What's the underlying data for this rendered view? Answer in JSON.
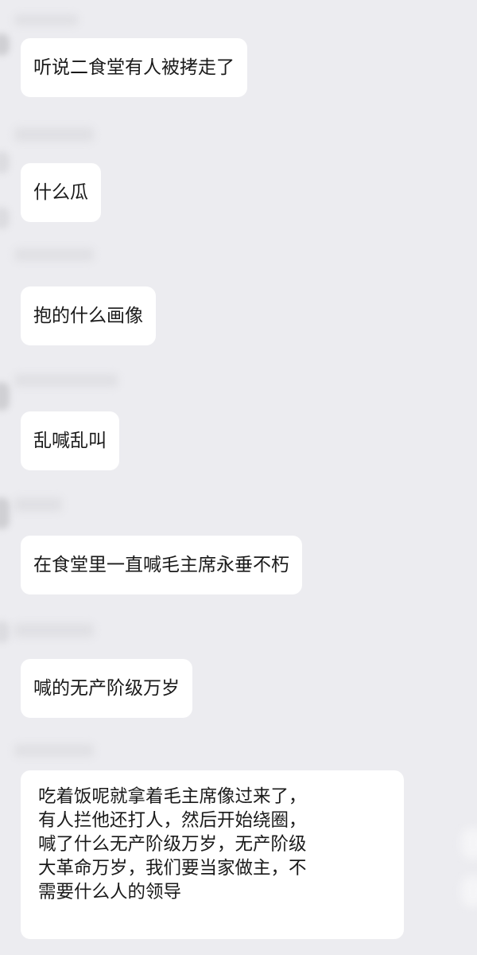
{
  "messages": [
    {
      "text": "听说二食堂有人被拷走了"
    },
    {
      "text": "什么瓜"
    },
    {
      "text": "抱的什么画像"
    },
    {
      "text": "乱喊乱叫"
    },
    {
      "text": "在食堂里一直喊毛主席永垂不朽"
    },
    {
      "text": "喊的无产阶级万岁"
    },
    {
      "lines": [
        "吃着饭呢就拿着毛主席像过来了，",
        "有人拦他还打人，然后开始绕圈，",
        "喊了什么无产阶级万岁，无产阶级",
        "大革命万岁，我们要当家做主，不",
        "需要什么人的领导"
      ]
    }
  ]
}
